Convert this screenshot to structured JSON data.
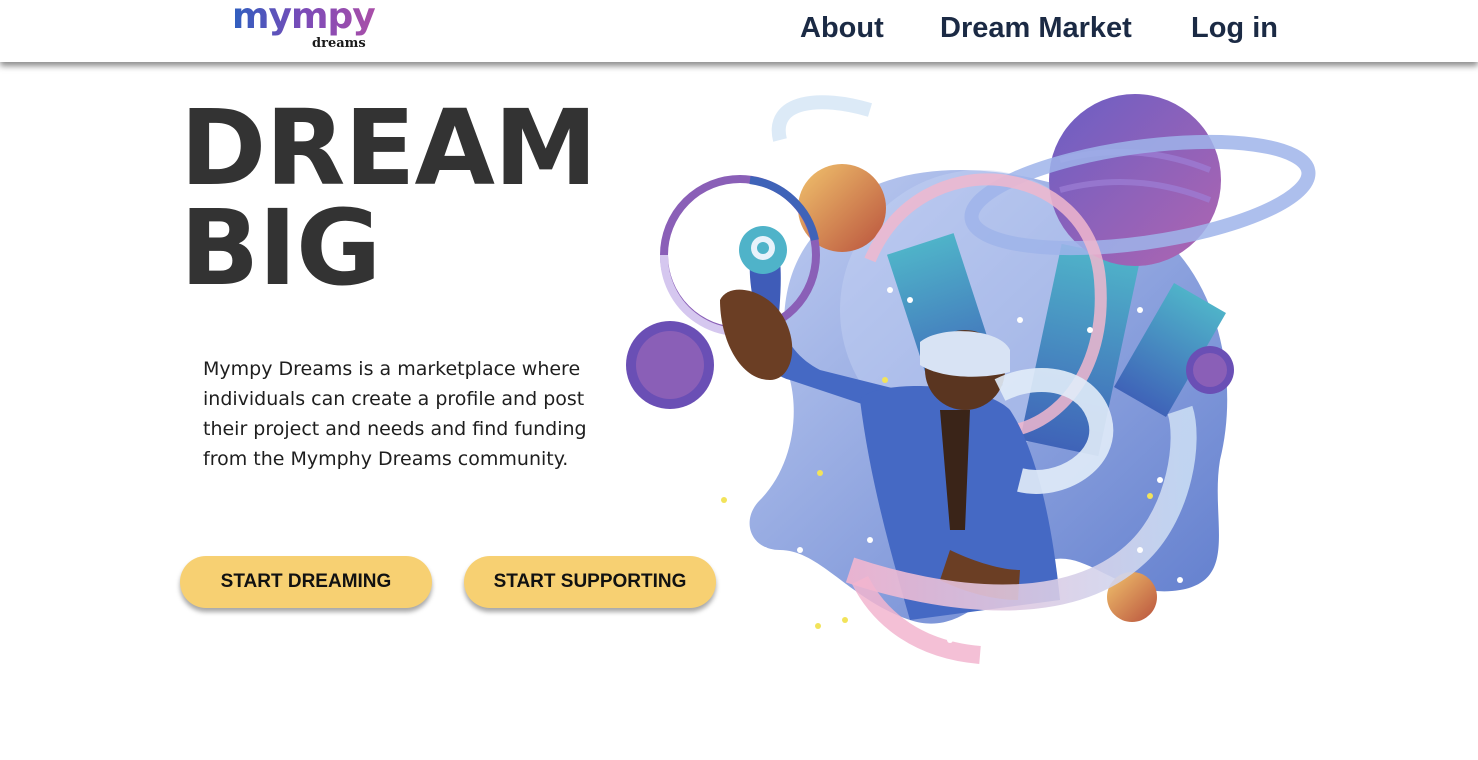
{
  "brand": {
    "logo_main": "mympy",
    "logo_sub": "dreams"
  },
  "nav": {
    "about": "About",
    "dream_market": "Dream Market",
    "login": "Log in"
  },
  "hero": {
    "headline_line1": "DREAM",
    "headline_line2": "BIG",
    "description": "Mympy Dreams is a marketplace where individuals can create a profile and post their project and needs and find funding from the Mymphy Dreams community.",
    "buttons": {
      "start_dreaming": "START DREAMING",
      "start_supporting": "START SUPPORTING"
    }
  },
  "colors": {
    "button": "#f7d072",
    "nav_text": "#1b2a44",
    "headline": "#333333",
    "illustration_primary": "#4f6fc8",
    "illustration_accent": "#8a5fb7"
  }
}
